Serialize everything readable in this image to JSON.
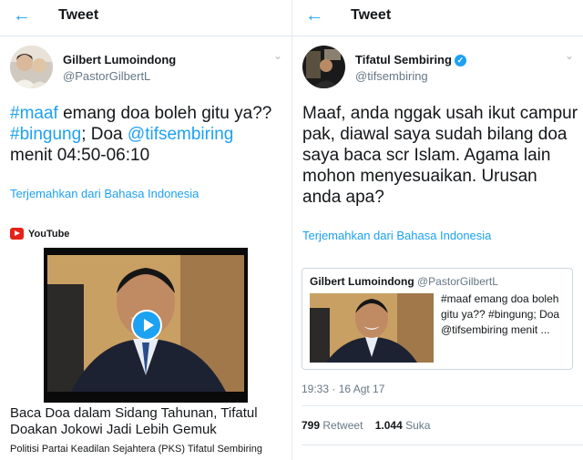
{
  "left": {
    "header_title": "Tweet",
    "user_name": "Gilbert Lumoindong",
    "user_handle": "@PastorGilbertL",
    "text_parts": [
      "#maaf",
      " emang doa boleh gitu ya??",
      "#bingung",
      "; Doa ",
      "@tifsembiring",
      "menit 04:50-06:10"
    ],
    "translate": "Terjemahkan dari Bahasa Indonesia",
    "card_source": "YouTube",
    "video_title": "Baca Doa dalam Sidang Tahunan, Tifatul Doakan Jokowi Jadi Lebih Gemuk",
    "video_desc": "Politisi Partai Keadilan Sejahtera (PKS) Tifatul Sembiring"
  },
  "right": {
    "header_title": "Tweet",
    "user_name": "Tifatul Sembiring",
    "user_handle": "@tifsembiring",
    "text": "Maaf, anda nggak usah ikut campur pak, diawal saya sudah bilang doa saya baca scr Islam. Agama lain mohon menyesuaikan. Urusan anda apa?",
    "translate": "Terjemahkan dari Bahasa Indonesia",
    "quote_name": "Gilbert Lumoindong",
    "quote_handle": "@PastorGilbertL",
    "quote_text": "#maaf emang doa boleh gitu ya?? #bingung; Doa @tifsembiring menit ...",
    "timestamp": "19:33 · 16 Agt 17",
    "retweet_count": "799",
    "retweet_label": "Retweet",
    "like_count": "1.044",
    "like_label": "Suka"
  },
  "icons": {
    "back": "back-arrow-icon",
    "menu": "chevron-down-icon",
    "verified": "verified-badge-icon",
    "play": "play-icon",
    "youtube": "youtube-icon"
  },
  "colors": {
    "accent": "#1da1f2",
    "text": "#14171a",
    "secondary": "#657786",
    "youtube": "#e62117"
  }
}
